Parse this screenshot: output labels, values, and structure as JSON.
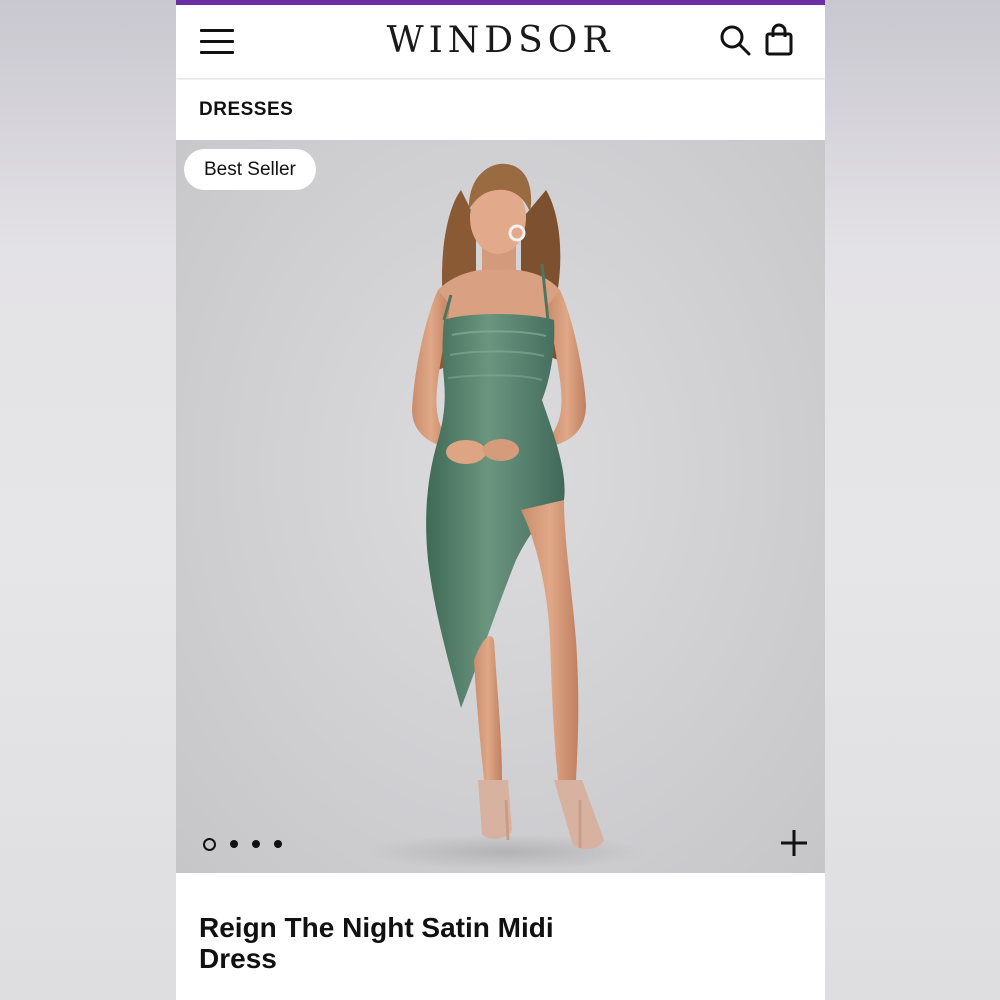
{
  "brand": {
    "logo_text": "WINDSOR",
    "accent_color": "#6a2fa5"
  },
  "header": {
    "menu_icon": "hamburger-menu-icon",
    "search_icon": "search-icon",
    "bag_icon": "shopping-bag-icon"
  },
  "breadcrumb": {
    "label": "DRESSES"
  },
  "product": {
    "badge": "Best Seller",
    "title": "Reign The Night Satin Midi Dress",
    "dress_color": "#56806b",
    "gallery": {
      "image_count": 4,
      "active_index": 0
    },
    "zoom_icon": "plus-icon"
  }
}
